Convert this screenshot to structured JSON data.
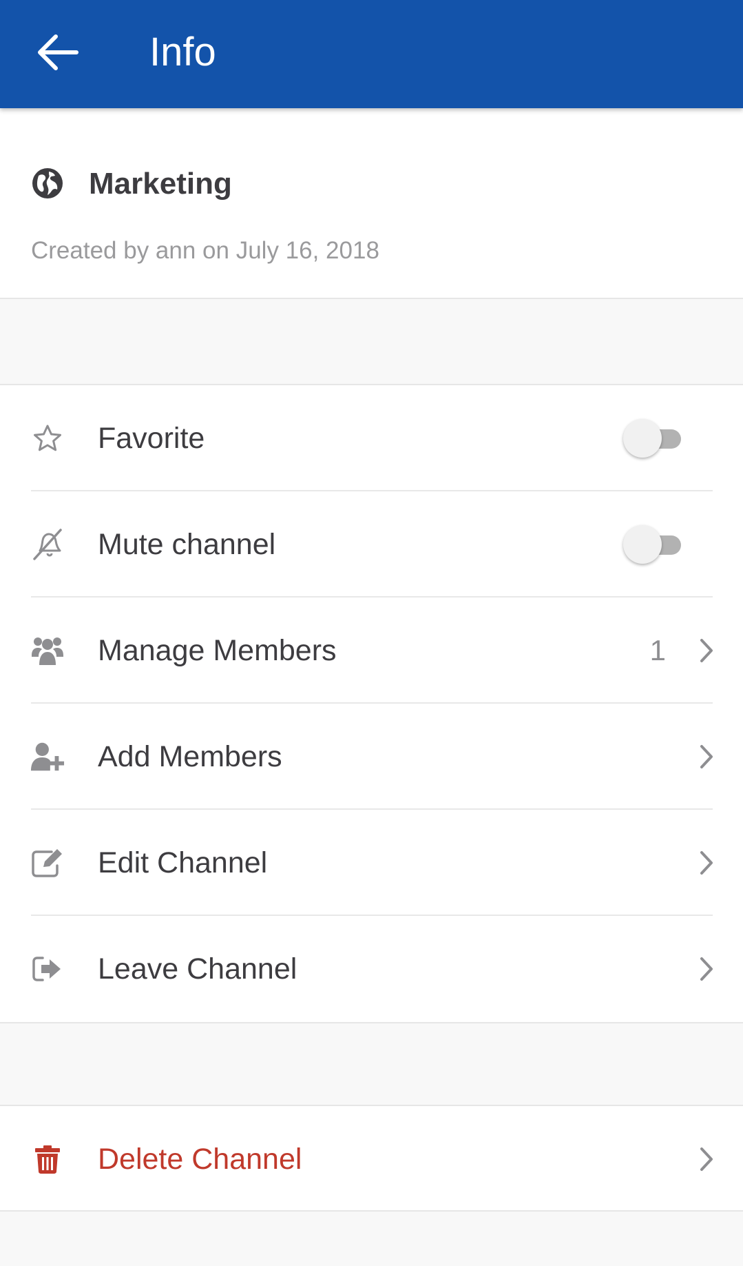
{
  "appbar": {
    "title": "Info",
    "back_icon": "arrow-left-icon"
  },
  "channel": {
    "name": "Marketing",
    "icon": "globe-icon",
    "created": "Created by ann on July 16, 2018"
  },
  "options": [
    {
      "label": "Favorite",
      "icon": "star-icon",
      "control": "toggle",
      "value": false
    },
    {
      "label": "Mute channel",
      "icon": "bell-off-icon",
      "control": "toggle",
      "value": false
    },
    {
      "label": "Manage Members",
      "icon": "users-icon",
      "control": "chevron",
      "count": "1"
    },
    {
      "label": "Add Members",
      "icon": "user-plus-icon",
      "control": "chevron"
    },
    {
      "label": "Edit Channel",
      "icon": "edit-icon",
      "control": "chevron"
    },
    {
      "label": "Leave Channel",
      "icon": "sign-out-icon",
      "control": "chevron"
    }
  ],
  "danger": {
    "label": "Delete Channel",
    "icon": "trash-icon"
  },
  "colors": {
    "appbar": "#1353aa",
    "text": "#3d3c40",
    "muted": "#9a9a9c",
    "danger": "#c0392b",
    "background": "#f8f8f8"
  }
}
